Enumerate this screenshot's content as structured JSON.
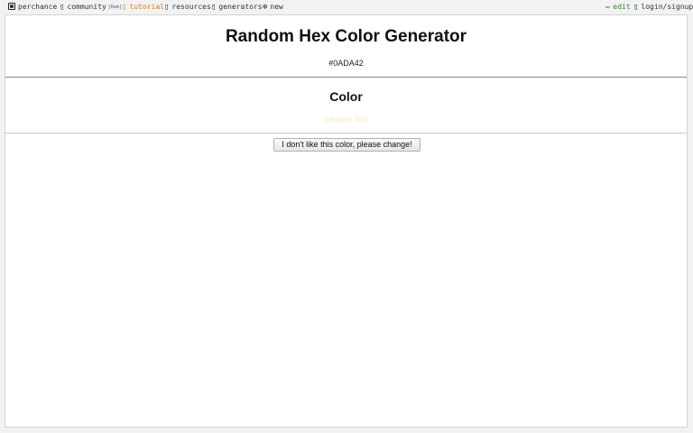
{
  "nav": {
    "brand": "perchance",
    "community": "community",
    "community_badge": "[6am]",
    "tutorial": "tutorial",
    "resources": "resources",
    "generators": "generators",
    "new": "new",
    "edit": "edit",
    "login": "login/signup"
  },
  "icons": {
    "brand": "dice-icon",
    "community": "chat-icon",
    "tutorial": "book-icon",
    "resources": "link-icon",
    "generators": "grid-icon",
    "new": "plus-circle-icon",
    "edit": "pencil-icon",
    "login": "user-icon"
  },
  "colors": {
    "tutorial": "#e07a1f",
    "edit": "#2e8b2e",
    "sample_text": "#fde5c8"
  },
  "main": {
    "title": "Random Hex Color Generator",
    "hex_value": "#0ADA42",
    "subtitle": "Color",
    "sample_text": "Sample Text",
    "change_button": "I don't like this color, please change!"
  }
}
